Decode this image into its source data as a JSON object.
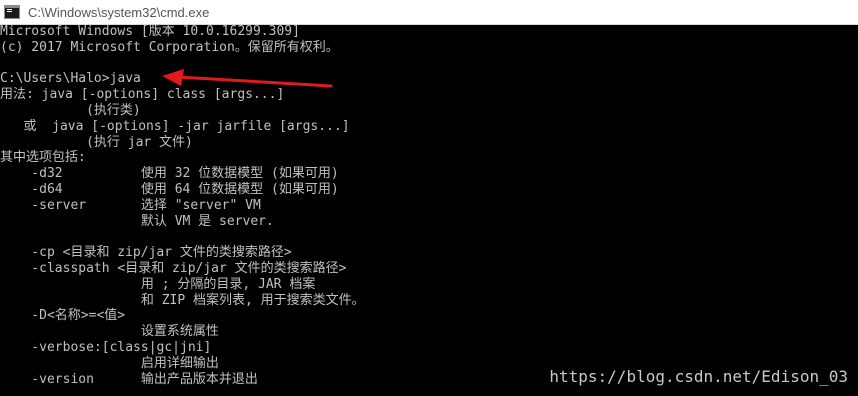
{
  "window": {
    "title": "C:\\Windows\\system32\\cmd.exe"
  },
  "console": {
    "lines": [
      "Microsoft Windows [版本 10.0.16299.309]",
      "(c) 2017 Microsoft Corporation。保留所有权利。",
      "",
      "C:\\Users\\Halo>java",
      "用法: java [-options] class [args...]",
      "           (执行类)",
      "   或  java [-options] -jar jarfile [args...]",
      "           (执行 jar 文件)",
      "其中选项包括:",
      "    -d32          使用 32 位数据模型 (如果可用)",
      "    -d64          使用 64 位数据模型 (如果可用)",
      "    -server       选择 \"server\" VM",
      "                  默认 VM 是 server.",
      "",
      "    -cp <目录和 zip/jar 文件的类搜索路径>",
      "    -classpath <目录和 zip/jar 文件的类搜索路径>",
      "                  用 ; 分隔的目录, JAR 档案",
      "                  和 ZIP 档案列表, 用于搜索类文件。",
      "    -D<名称>=<值>",
      "                  设置系统属性",
      "    -verbose:[class|gc|jni]",
      "                  启用详细输出",
      "    -version      输出产品版本并退出"
    ]
  },
  "watermark": "https://blog.csdn.net/Edison_03",
  "colors": {
    "console_bg": "#000000",
    "console_text": "#c0c0c0",
    "arrow": "#e01b1b"
  },
  "icons": {
    "app": "cmd-app-icon",
    "annotation": "red-arrow-icon"
  }
}
